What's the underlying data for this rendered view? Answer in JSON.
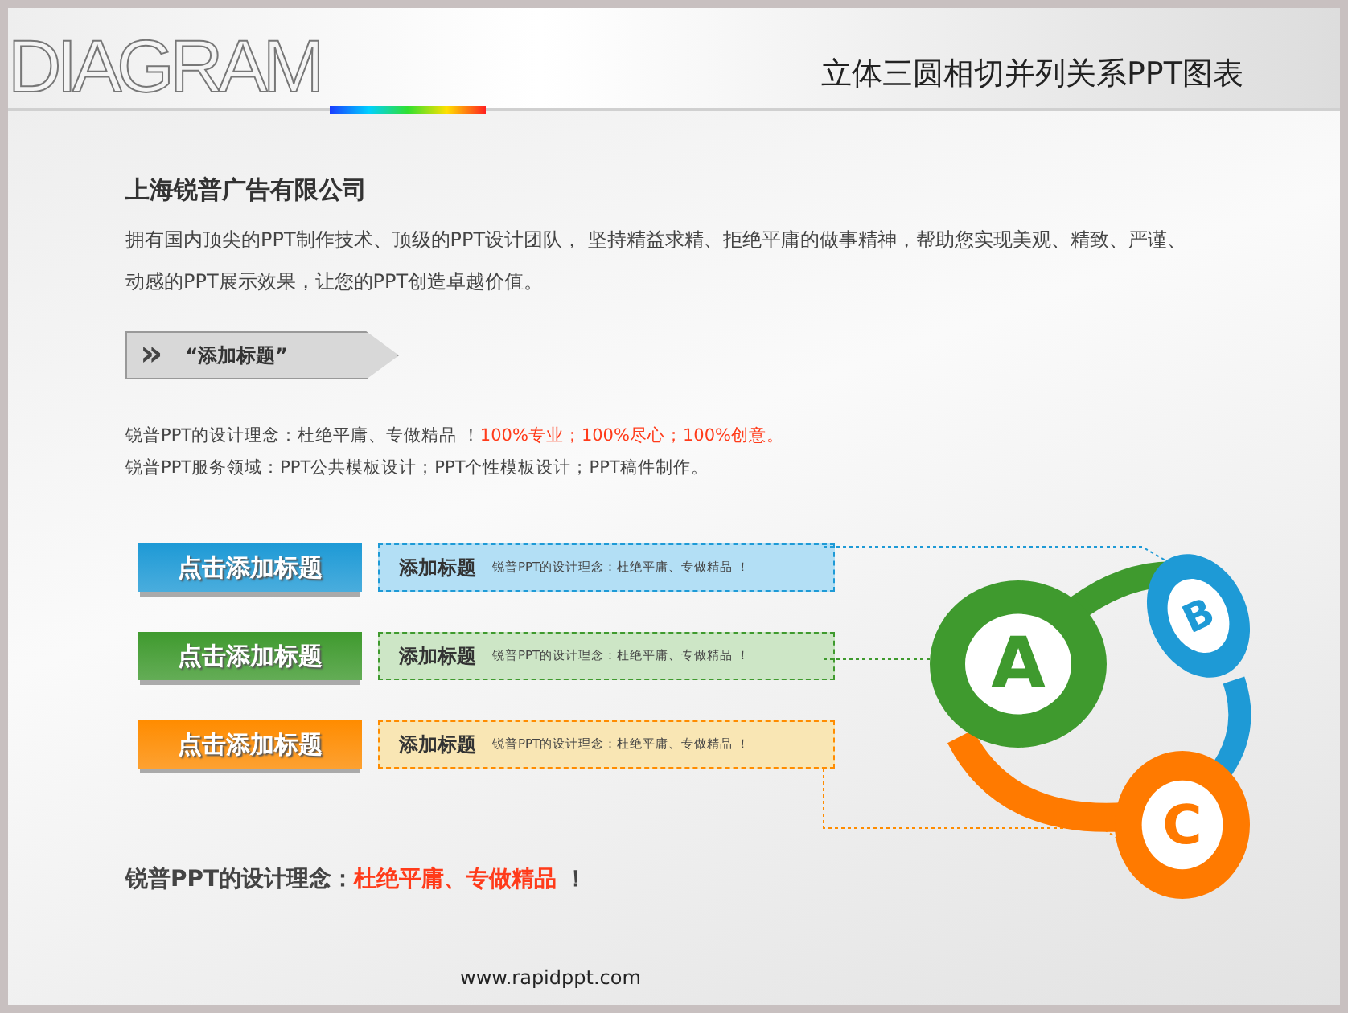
{
  "header": {
    "logo": "DIAGRAM",
    "title": "立体三圆相切并列关系PPT图表"
  },
  "company": {
    "name": "上海锐普广告有限公司",
    "description": "拥有国内顶尖的PPT制作技术、顶级的PPT设计团队， 坚持精益求精、拒绝平庸的做事精神，帮助您实现美观、精致、严谨、动感的PPT展示效果，让您的PPT创造卓越价值。"
  },
  "tag": {
    "chevrons": "»",
    "label": "“添加标题”"
  },
  "notes": [
    {
      "text": "锐普PPT的设计理念：杜绝平庸、专做精品 ！",
      "emphasis": "100%专业；100%尽心；100%创意。"
    },
    {
      "text": "锐普PPT服务领域：PPT公共模板设计；PPT个性模板设计；PPT稿件制作。"
    }
  ],
  "rows": [
    {
      "button": "点击添加标题",
      "title": "添加标题",
      "text": "锐普PPT的设计理念：杜绝平庸、专做精品 ！",
      "color": "#1e9ad6"
    },
    {
      "button": "点击添加标题",
      "title": "添加标题",
      "text": "锐普PPT的设计理念：杜绝平庸、专做精品 ！",
      "color": "#3f9a2e"
    },
    {
      "button": "点击添加标题",
      "title": "添加标题",
      "text": "锐普PPT的设计理念：杜绝平庸、专做精品 ！",
      "color": "#ff8c00"
    }
  ],
  "circles": [
    {
      "letter": "A",
      "color": "#3f9a2e"
    },
    {
      "letter": "B",
      "color": "#1e9ad6"
    },
    {
      "letter": "C",
      "color": "#ff7a00"
    }
  ],
  "slogan": {
    "lead": "锐普PPT的设计理念：",
    "emphasis": "杜绝平庸、专做精品",
    "tail": "！"
  },
  "footer": "www.rapidppt.com"
}
